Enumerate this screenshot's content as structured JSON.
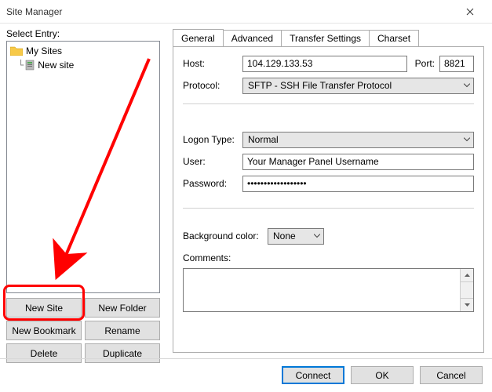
{
  "window": {
    "title": "Site Manager"
  },
  "left": {
    "select_label": "Select Entry:",
    "tree": {
      "root": "My Sites",
      "items": [
        "New site"
      ]
    },
    "buttons": {
      "new_site": "New Site",
      "new_folder": "New Folder",
      "new_bookmark": "New Bookmark",
      "rename": "Rename",
      "delete": "Delete",
      "duplicate": "Duplicate"
    }
  },
  "tabs": {
    "general": "General",
    "advanced": "Advanced",
    "transfer": "Transfer Settings",
    "charset": "Charset"
  },
  "general": {
    "host_label": "Host:",
    "host_value": "104.129.133.53",
    "port_label": "Port:",
    "port_value": "8821",
    "protocol_label": "Protocol:",
    "protocol_value": "SFTP - SSH File Transfer Protocol",
    "logon_label": "Logon Type:",
    "logon_value": "Normal",
    "user_label": "User:",
    "user_value": "Your Manager Panel Username",
    "password_label": "Password:",
    "password_value": "••••••••••••••••••",
    "bg_label": "Background color:",
    "bg_value": "None",
    "comments_label": "Comments:"
  },
  "footer": {
    "connect": "Connect",
    "ok": "OK",
    "cancel": "Cancel"
  }
}
